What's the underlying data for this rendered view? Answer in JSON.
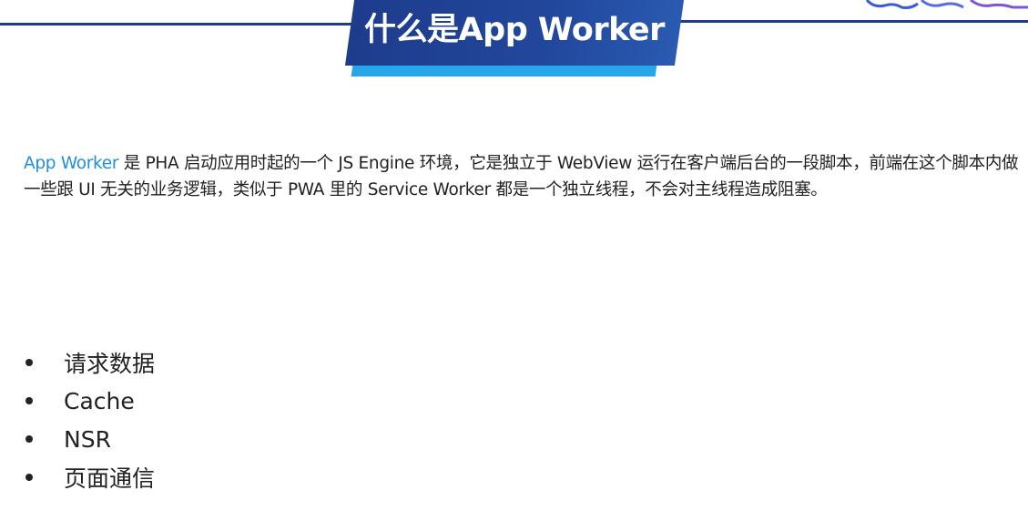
{
  "slide": {
    "title": "什么是App Worker",
    "paragraph": {
      "highlight": "App Worker",
      "rest": " 是 PHA 启动应用时起的一个 JS Engine 环境，它是独立于 WebView 运行在客户端后台的一段脚本，前端在这个脚本内做一些跟 UI 无关的业务逻辑，类似于 PWA 里的 Service Worker 都是一个独立线程，不会对主线程造成阻塞。"
    },
    "bullets": [
      "请求数据",
      "Cache",
      "NSR",
      "页面通信"
    ]
  },
  "colors": {
    "banner": "#1e3c8c",
    "banner_accent": "#27a6ea",
    "highlight_text": "#1e8ee0",
    "body_text": "#222222"
  },
  "icons": {
    "logo": "brand-logo-icon"
  }
}
